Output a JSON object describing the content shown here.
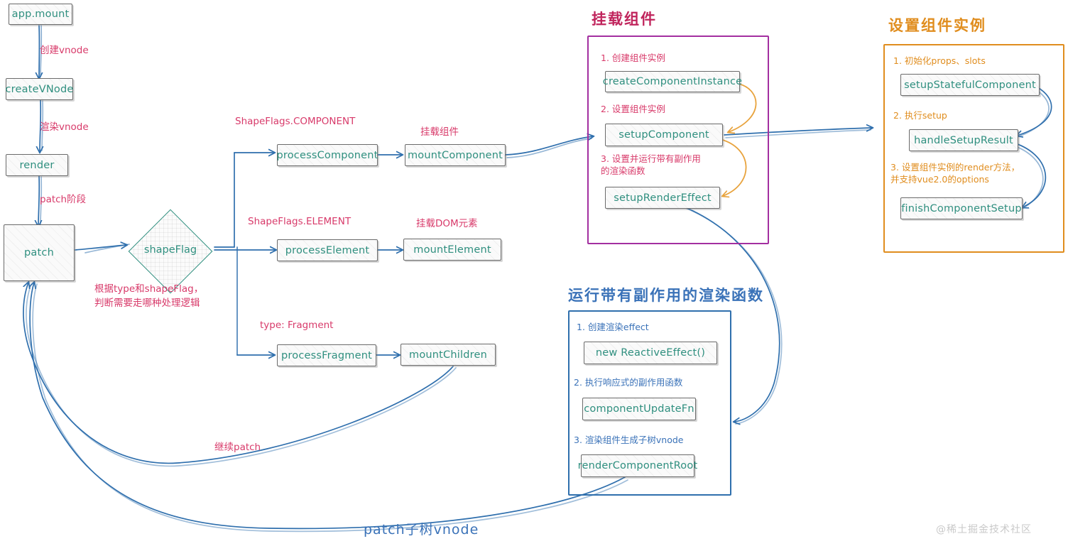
{
  "diagram": {
    "title_watermark": "@稀土掘金技术社区",
    "colors": {
      "node_text": "#2f8f7f",
      "node_border": "#6b6b6b",
      "edge": "#2f6fad",
      "orange_edge": "#e8a33d",
      "crimson": "#d83a6a",
      "purple": "#a32fa0",
      "orange": "#e08d1e",
      "blue": "#2f6fad"
    }
  },
  "nodes": {
    "app_mount": "app.mount",
    "create_vnode": "createVNode",
    "render": "render",
    "patch": "patch",
    "shape_flag": "shapeFlag",
    "process_component": "processComponent",
    "mount_component": "mountComponent",
    "process_element": "processElement",
    "mount_element": "mountElement",
    "process_fragment": "processFragment",
    "mount_children": "mountChildren"
  },
  "edge_labels": {
    "create_vnode": "创建vnode",
    "render_vnode": "渲染vnode",
    "patch_stage": "patch阶段",
    "shapeflags_component": "ShapeFlags.COMPONENT",
    "shapeflags_element": "ShapeFlags.ELEMENT",
    "type_fragment": "type: Fragment",
    "mount_component_cn": "挂载组件",
    "mount_dom_cn": "挂载DOM元素",
    "decide_branch": "根据type和shapeFlag，\n判断需要走哪种处理逻辑",
    "continue_patch": "继续patch",
    "patch_subtree": "patch子树vnode"
  },
  "panels": {
    "mount_component": {
      "title": "挂载组件",
      "color": "#a32fa0",
      "title_color": "#c0245c",
      "label_color": "#d83a6a",
      "steps": [
        {
          "label": "1. 创建组件实例",
          "node": "createComponentInstance"
        },
        {
          "label": "2. 设置组件实例",
          "node": "setupComponent"
        },
        {
          "label": "3. 设置并运行带有副作用\n    的渲染函数",
          "node": "setupRenderEffect"
        }
      ]
    },
    "setup_component": {
      "title": "设置组件实例",
      "color": "#e08d1e",
      "title_color": "#e08d1e",
      "label_color": "#e08d1e",
      "steps": [
        {
          "label": "1. 初始化props、slots",
          "node": "setupStatefulComponent"
        },
        {
          "label": "2. 执行setup",
          "node": "handleSetupResult"
        },
        {
          "label": "3. 设置组件实例的render方法，\n并支持vue2.0的options",
          "node": "finishComponentSetup"
        }
      ]
    },
    "render_effect": {
      "title": "运行带有副作用的渲染函数",
      "color": "#2f6fad",
      "title_color": "#3a72b8",
      "label_color": "#3a72b8",
      "steps": [
        {
          "label": "1. 创建渲染effect",
          "node": "new ReactiveEffect()"
        },
        {
          "label": "2. 执行响应式的副作用函数",
          "node": "componentUpdateFn"
        },
        {
          "label": "3. 渲染组件生成子树vnode",
          "node": "renderComponentRoot"
        }
      ]
    }
  }
}
